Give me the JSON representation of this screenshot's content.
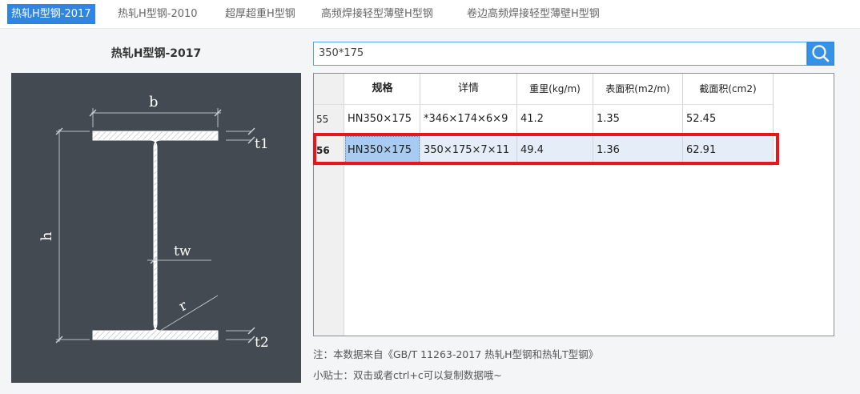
{
  "tabs": [
    {
      "label": "热轧H型钢-2017",
      "active": true
    },
    {
      "label": "热轧H型钢-2010",
      "active": false
    },
    {
      "label": "超厚超重H型钢",
      "active": false
    },
    {
      "label": "高频焊接轻型薄壁H型钢",
      "active": false
    },
    {
      "label": "卷边高频焊接轻型薄壁H型钢",
      "active": false
    }
  ],
  "left": {
    "title": "热轧H型钢-2017",
    "diagram_labels": {
      "b": "b",
      "t1": "t1",
      "h": "h",
      "tw": "tw",
      "r": "r",
      "t2": "t2"
    }
  },
  "search": {
    "value": "350*175",
    "icon": "search-icon"
  },
  "table": {
    "headers": [
      "规格",
      "详情",
      "重里(kg/m)",
      "表面积(m2/m)",
      "截面积(cm2)"
    ],
    "rows": [
      {
        "num": "55",
        "cells": [
          "HN350×175",
          "*346×174×6×9",
          "41.2",
          "1.35",
          "52.45"
        ],
        "selected": false
      },
      {
        "num": "56",
        "cells": [
          "HN350×175",
          "350×175×7×11",
          "49.4",
          "1.36",
          "62.91"
        ],
        "selected": true
      }
    ]
  },
  "notes": {
    "source": "注：本数据来自《GB/T 11263-2017 热轧H型钢和热轧T型钢》",
    "tip": "小贴士：双击或者ctrl+c可以复制数据哦~"
  },
  "colors": {
    "accent": "#2f86e0",
    "highlight": "#e8161a",
    "diagram_bg": "#434a52"
  }
}
